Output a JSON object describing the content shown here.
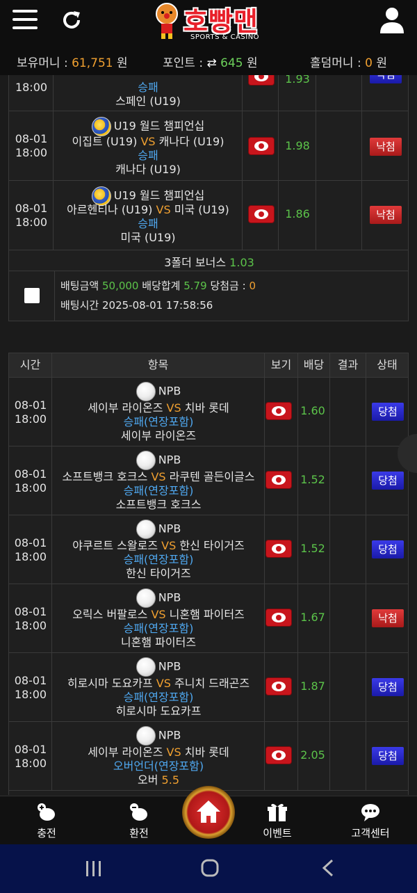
{
  "header": {
    "logo_text": "호빵맨",
    "logo_sub": "SPORTS & CASINO",
    "balance_label": "보유머니 :",
    "balance_value": "61,751",
    "balance_unit": "원",
    "points_label": "포인트 :",
    "points_value": "645",
    "points_unit": "원",
    "holdem_label": "홀덤머니 :",
    "holdem_value": "0",
    "holdem_unit": "원"
  },
  "ticket1": {
    "rows": [
      {
        "date": "",
        "time": "18:00",
        "league": "",
        "home": "",
        "away": "",
        "market": "승패",
        "pick": "스페인 (U19)",
        "odds": "1.93",
        "status": "낙첨"
      },
      {
        "date": "08-01",
        "time": "18:00",
        "league": "U19 월드 챔피언십",
        "home": "이집트 (U19)",
        "away": "캐나다 (U19)",
        "market": "승패",
        "pick": "캐나다 (U19)",
        "odds": "1.98",
        "status": "낙첨"
      },
      {
        "date": "08-01",
        "time": "18:00",
        "league": "U19 월드 챔피언십",
        "home": "아르헨티나 (U19)",
        "away": "미국 (U19)",
        "market": "승패",
        "pick": "미국 (U19)",
        "odds": "1.86",
        "status": "낙첨"
      }
    ],
    "vs": "VS",
    "bonus_label": "3폴더 보너스",
    "bonus_value": "1.03",
    "bet_amount_label": "배팅금액",
    "bet_amount_value": "50,000",
    "odds_total_label": "배당합계",
    "odds_total_value": "5.79",
    "win_label": "당첨금 :",
    "win_value": "0",
    "bet_time_label": "배팅시간",
    "bet_time_value": "2025-08-01 17:58:56"
  },
  "ticket2": {
    "headers": [
      "시간",
      "항목",
      "보기",
      "배당",
      "결과",
      "상태"
    ],
    "vs": "VS",
    "rows": [
      {
        "date": "08-01",
        "time": "18:00",
        "league": "NPB",
        "home": "세이부 라이온즈",
        "away": "치바 롯데",
        "market": "승패(연장포함)",
        "pick": "세이부 라이온즈",
        "pick_extra": "",
        "odds": "1.60",
        "status": "당첨",
        "status_color": "blue"
      },
      {
        "date": "08-01",
        "time": "18:00",
        "league": "NPB",
        "home": "소프트뱅크 호크스",
        "away": "라쿠텐 골든이글스",
        "market": "승패(연장포함)",
        "pick": "소프트뱅크 호크스",
        "pick_extra": "",
        "odds": "1.52",
        "status": "당첨",
        "status_color": "blue"
      },
      {
        "date": "08-01",
        "time": "18:00",
        "league": "NPB",
        "home": "야쿠르트 스왈로즈",
        "away": "한신 타이거즈",
        "market": "승패(연장포함)",
        "pick": "한신 타이거즈",
        "pick_extra": "",
        "odds": "1.52",
        "status": "당첨",
        "status_color": "blue"
      },
      {
        "date": "08-01",
        "time": "18:00",
        "league": "NPB",
        "home": "오릭스 버팔로스",
        "away": "니혼햄 파이터즈",
        "market": "승패(연장포함)",
        "pick": "니혼햄 파이터즈",
        "pick_extra": "",
        "odds": "1.67",
        "status": "낙첨",
        "status_color": "red"
      },
      {
        "date": "08-01",
        "time": "18:00",
        "league": "NPB",
        "home": "히로시마 도요카프",
        "away": "주니치 드래곤즈",
        "market": "승패(연장포함)",
        "pick": "히로시마 도요카프",
        "pick_extra": "",
        "odds": "1.87",
        "status": "당첨",
        "status_color": "blue"
      },
      {
        "date": "08-01",
        "time": "18:00",
        "league": "NPB",
        "home": "세이부 라이온즈",
        "away": "치바 롯데",
        "market": "오버언더(연장포함)",
        "pick": "오버",
        "pick_extra": "5.5",
        "odds": "2.05",
        "status": "당첨",
        "status_color": "blue"
      }
    ]
  },
  "nav": {
    "deposit": "충전",
    "withdraw": "환전",
    "event": "이벤트",
    "support": "고객센터"
  },
  "colors": {
    "accent_orange": "#f0a030",
    "odds_green": "#5cc44a",
    "market_blue": "#4fa8f0",
    "lose_red": "#c8151c",
    "win_blue": "#2a2ad0"
  }
}
